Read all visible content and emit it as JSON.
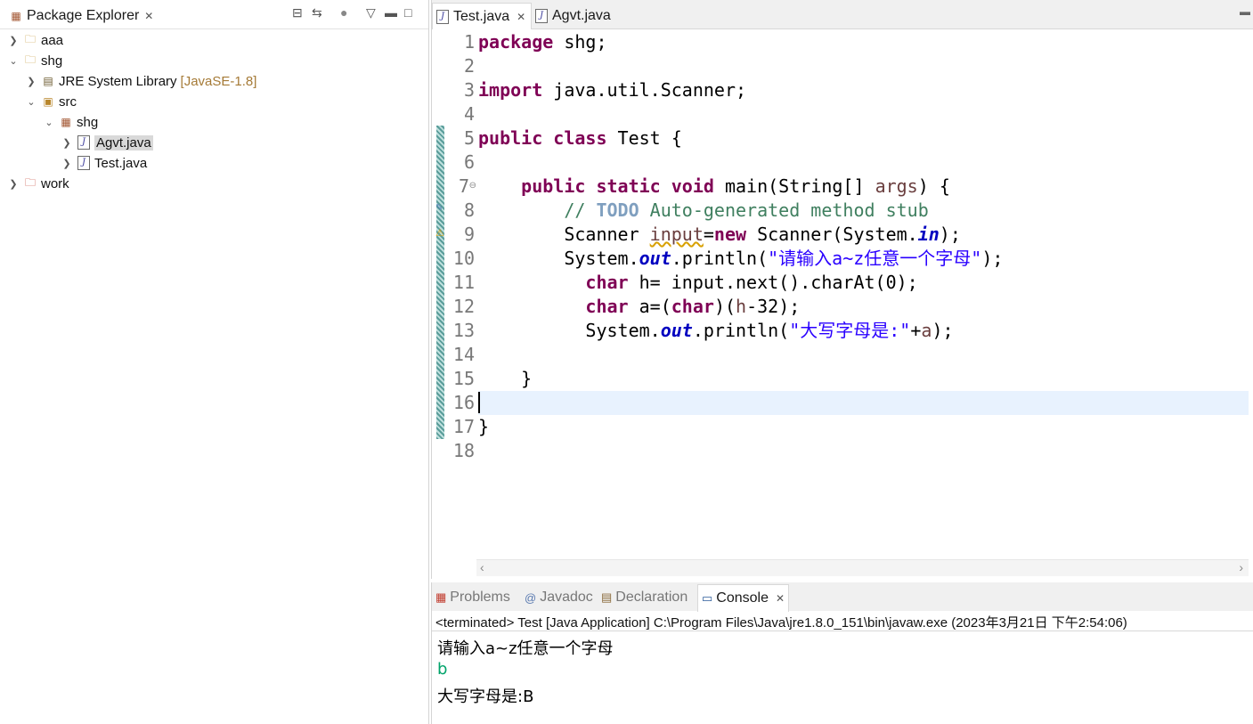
{
  "package_explorer": {
    "title": "Package Explorer",
    "tree": [
      {
        "label": "aaa",
        "decoration": "",
        "expanded": false
      },
      {
        "label": "shg",
        "decoration": "",
        "expanded": true
      },
      {
        "label": "JRE System Library",
        "decoration": "[JavaSE-1.8]",
        "expanded": false
      },
      {
        "label": "src",
        "decoration": "",
        "expanded": true
      },
      {
        "label": "shg",
        "decoration": "",
        "expanded": true
      },
      {
        "label": "Agvt.java",
        "decoration": "",
        "expanded": false
      },
      {
        "label": "Test.java",
        "decoration": "",
        "expanded": false
      },
      {
        "label": "work",
        "decoration": "",
        "expanded": false
      }
    ]
  },
  "editor": {
    "tabs": [
      {
        "label": "Test.java",
        "active": true
      },
      {
        "label": "Agvt.java",
        "active": false
      }
    ],
    "line_numbers": [
      "1",
      "2",
      "3",
      "4",
      "5",
      "6",
      "7",
      "8",
      "9",
      "10",
      "11",
      "12",
      "13",
      "14",
      "15",
      "16",
      "17",
      "18"
    ],
    "code": {
      "l1_kw": "package",
      "l1_rest": " shg;",
      "l3_kw": "import",
      "l3_rest": " java.util.Scanner;",
      "l5_kw1": "public",
      "l5_kw2": "class",
      "l5_rest": " Test {",
      "l7_kw1": "public",
      "l7_kw2": "static",
      "l7_kw3": "void",
      "l7_mid": " main(String[] ",
      "l7_param": "args",
      "l7_end": ") {",
      "l8_slash": "// ",
      "l8_todo": "TODO",
      "l8_rest": " Auto-generated method stub",
      "l9_a": "Scanner ",
      "l9_var": "input",
      "l9_b": "=",
      "l9_kw": "new",
      "l9_c": " Scanner(System.",
      "l9_fld": "in",
      "l9_d": ");",
      "l10_a": "System.",
      "l10_fld": "out",
      "l10_b": ".println(",
      "l10_str": "\"请输入a~z任意一个字母\"",
      "l10_c": ");",
      "l11_kw": "char",
      "l11_rest": " h= input.next().charAt(0);",
      "l12_kw": "char",
      "l12_a": " a=(",
      "l12_kw2": "char",
      "l12_b": ")(",
      "l12_h": "h",
      "l12_c": "-32);",
      "l13_a": "System.",
      "l13_fld": "out",
      "l13_b": ".println(",
      "l13_str": "\"大写字母是:\"",
      "l13_c": "+",
      "l13_var": "a",
      "l13_d": ");",
      "l15": "}",
      "l17": "}"
    }
  },
  "bottom_panel": {
    "tabs": [
      {
        "label": "Problems",
        "icon": "problems-icon",
        "active": false
      },
      {
        "label": "Javadoc",
        "icon": "javadoc-icon",
        "active": false
      },
      {
        "label": "Declaration",
        "icon": "declaration-icon",
        "active": false
      },
      {
        "label": "Console",
        "icon": "console-icon",
        "active": true
      }
    ],
    "terminated": "<terminated> Test [Java Application] C:\\Program Files\\Java\\jre1.8.0_151\\bin\\javaw.exe (2023年3月21日 下午2:54:06)",
    "output": [
      {
        "text": "请输入a~z任意一个字母",
        "kind": "stdout"
      },
      {
        "text": "b",
        "kind": "stdin"
      },
      {
        "text": "大写字母是:B",
        "kind": "stdout"
      }
    ]
  },
  "colors": {
    "keyword": "#7f0055",
    "comment": "#3f7f5f",
    "string": "#2a00ff",
    "field": "#0000c0",
    "console_input": "#00a36a",
    "current_line": "#e8f2fe"
  }
}
